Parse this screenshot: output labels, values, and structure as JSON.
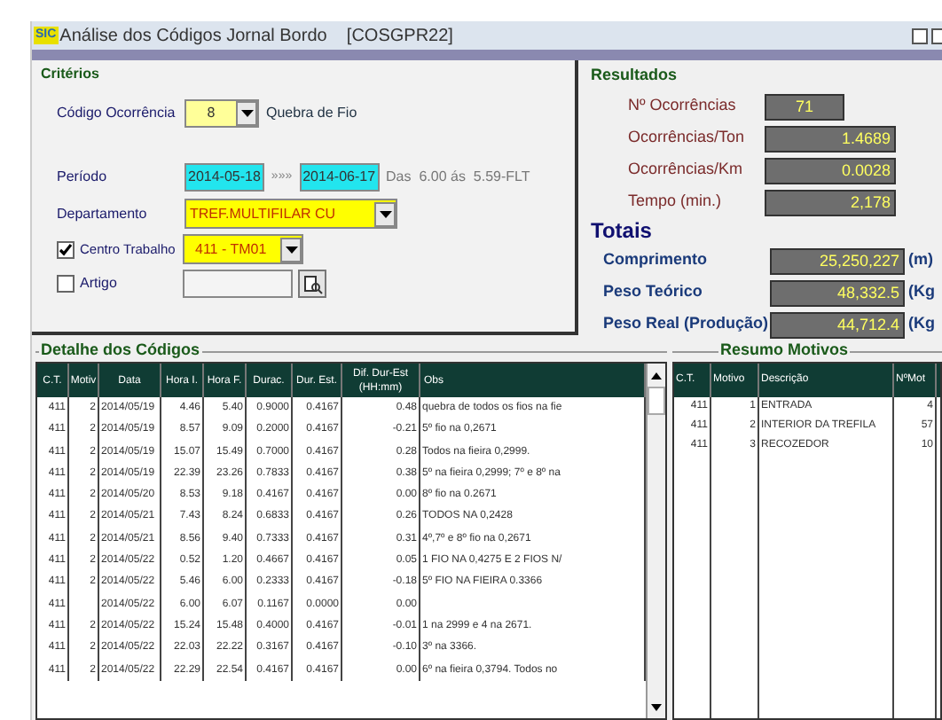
{
  "window": {
    "icon": "SIC",
    "title": "Análise dos Códigos Jornal Bordo    [COSGPR22]"
  },
  "criterios": {
    "title": "Critérios",
    "codigo_label": "Código Ocorrência",
    "codigo_value": "8",
    "codigo_desc": "Quebra de Fio",
    "periodo_label": "Período",
    "date_from": "2014-05-18",
    "separator": "»»»",
    "date_to": "2014-06-17",
    "hours": "Das  6.00 ás  5.59-FLT",
    "departamento_label": "Departamento",
    "departamento_value": "TREF.MULTIFILAR CU",
    "centro_label": "Centro Trabalho",
    "centro_checked": true,
    "centro_value": "411 - TM01",
    "artigo_label": "Artigo",
    "artigo_checked": false
  },
  "resultados": {
    "title": "Resultados",
    "items": [
      {
        "label": "Nº Ocorrências",
        "value": "71"
      },
      {
        "label": "Ocorrências/Ton",
        "value": "1.4689"
      },
      {
        "label": "Ocorrências/Km",
        "value": "0.0028"
      },
      {
        "label": "Tempo (min.)",
        "value": "2,178"
      }
    ]
  },
  "totais": {
    "title": "Totais",
    "items": [
      {
        "label": "Comprimento",
        "value": "25,250,227",
        "unit": "(m)"
      },
      {
        "label": "Peso Teórico",
        "value": "48,332.5",
        "unit": "(Kg"
      },
      {
        "label": "Peso Real (Produção)",
        "value": "44,712.4",
        "unit": "(Kg"
      }
    ]
  },
  "detalhe": {
    "title": "Detalhe dos Códigos",
    "columns": [
      "C.T.",
      "Motiv",
      "Data",
      "Hora I.",
      "Hora F.",
      "Durac.",
      "Dur. Est.",
      "Dif. Dur-Est (HH:mm)",
      "Obs"
    ],
    "rows": [
      [
        "411",
        "2",
        "2014/05/19",
        "4.46",
        "5.40",
        "0.9000",
        "0.4167",
        "0.48",
        "quebra de todos os fios na fie"
      ],
      [
        "411",
        "2",
        "2014/05/19",
        "8.57",
        "9.09",
        "0.2000",
        "0.4167",
        "-0.21",
        "5º fio na 0,2671"
      ],
      [
        "411",
        "2",
        "2014/05/19",
        "15.07",
        "15.49",
        "0.7000",
        "0.4167",
        "0.28",
        "Todos na fieira 0,2999."
      ],
      [
        "411",
        "2",
        "2014/05/19",
        "22.39",
        "23.26",
        "0.7833",
        "0.4167",
        "0.38",
        "5º na fieira 0,2999; 7º e 8º na"
      ],
      [
        "411",
        "2",
        "2014/05/20",
        "8.53",
        "9.18",
        "0.4167",
        "0.4167",
        "0.00",
        "8º  fio  na  0.2671"
      ],
      [
        "411",
        "2",
        "2014/05/21",
        "7.43",
        "8.24",
        "0.6833",
        "0.4167",
        "0.26",
        "TODOS NA 0,2428"
      ],
      [
        "411",
        "2",
        "2014/05/21",
        "8.56",
        "9.40",
        "0.7333",
        "0.4167",
        "0.31",
        "4º,7º e 8º fio na 0,2671"
      ],
      [
        "411",
        "2",
        "2014/05/22",
        "0.52",
        "1.20",
        "0.4667",
        "0.4167",
        "0.05",
        "1 FIO NA 0,4275 E 2 FIOS N/"
      ],
      [
        "411",
        "2",
        "2014/05/22",
        "5.46",
        "6.00",
        "0.2333",
        "0.4167",
        "-0.18",
        "5º FIO NA FIEIRA 0.3366"
      ],
      [
        "411",
        "",
        "2014/05/22",
        "6.00",
        "6.07",
        "0.1167",
        "0.0000",
        "0.00",
        ""
      ],
      [
        "411",
        "2",
        "2014/05/22",
        "15.24",
        "15.48",
        "0.4000",
        "0.4167",
        "-0.01",
        "1 na 2999 e 4 na 2671."
      ],
      [
        "411",
        "2",
        "2014/05/22",
        "22.03",
        "22.22",
        "0.3167",
        "0.4167",
        "-0.10",
        "3º na 3366."
      ],
      [
        "411",
        "2",
        "2014/05/22",
        "22.29",
        "22.54",
        "0.4167",
        "0.4167",
        "0.00",
        "6º na fieira 0,3794. Todos no"
      ]
    ]
  },
  "resumo": {
    "title": "Resumo Motivos",
    "columns": [
      "C.T.",
      "Motivo",
      "Descrição",
      "NºMot"
    ],
    "rows": [
      [
        "411",
        "1",
        "ENTRADA",
        "4"
      ],
      [
        "411",
        "2",
        "INTERIOR DA TREFILA",
        "57"
      ],
      [
        "411",
        "3",
        "RECOZEDOR",
        "10"
      ]
    ]
  }
}
